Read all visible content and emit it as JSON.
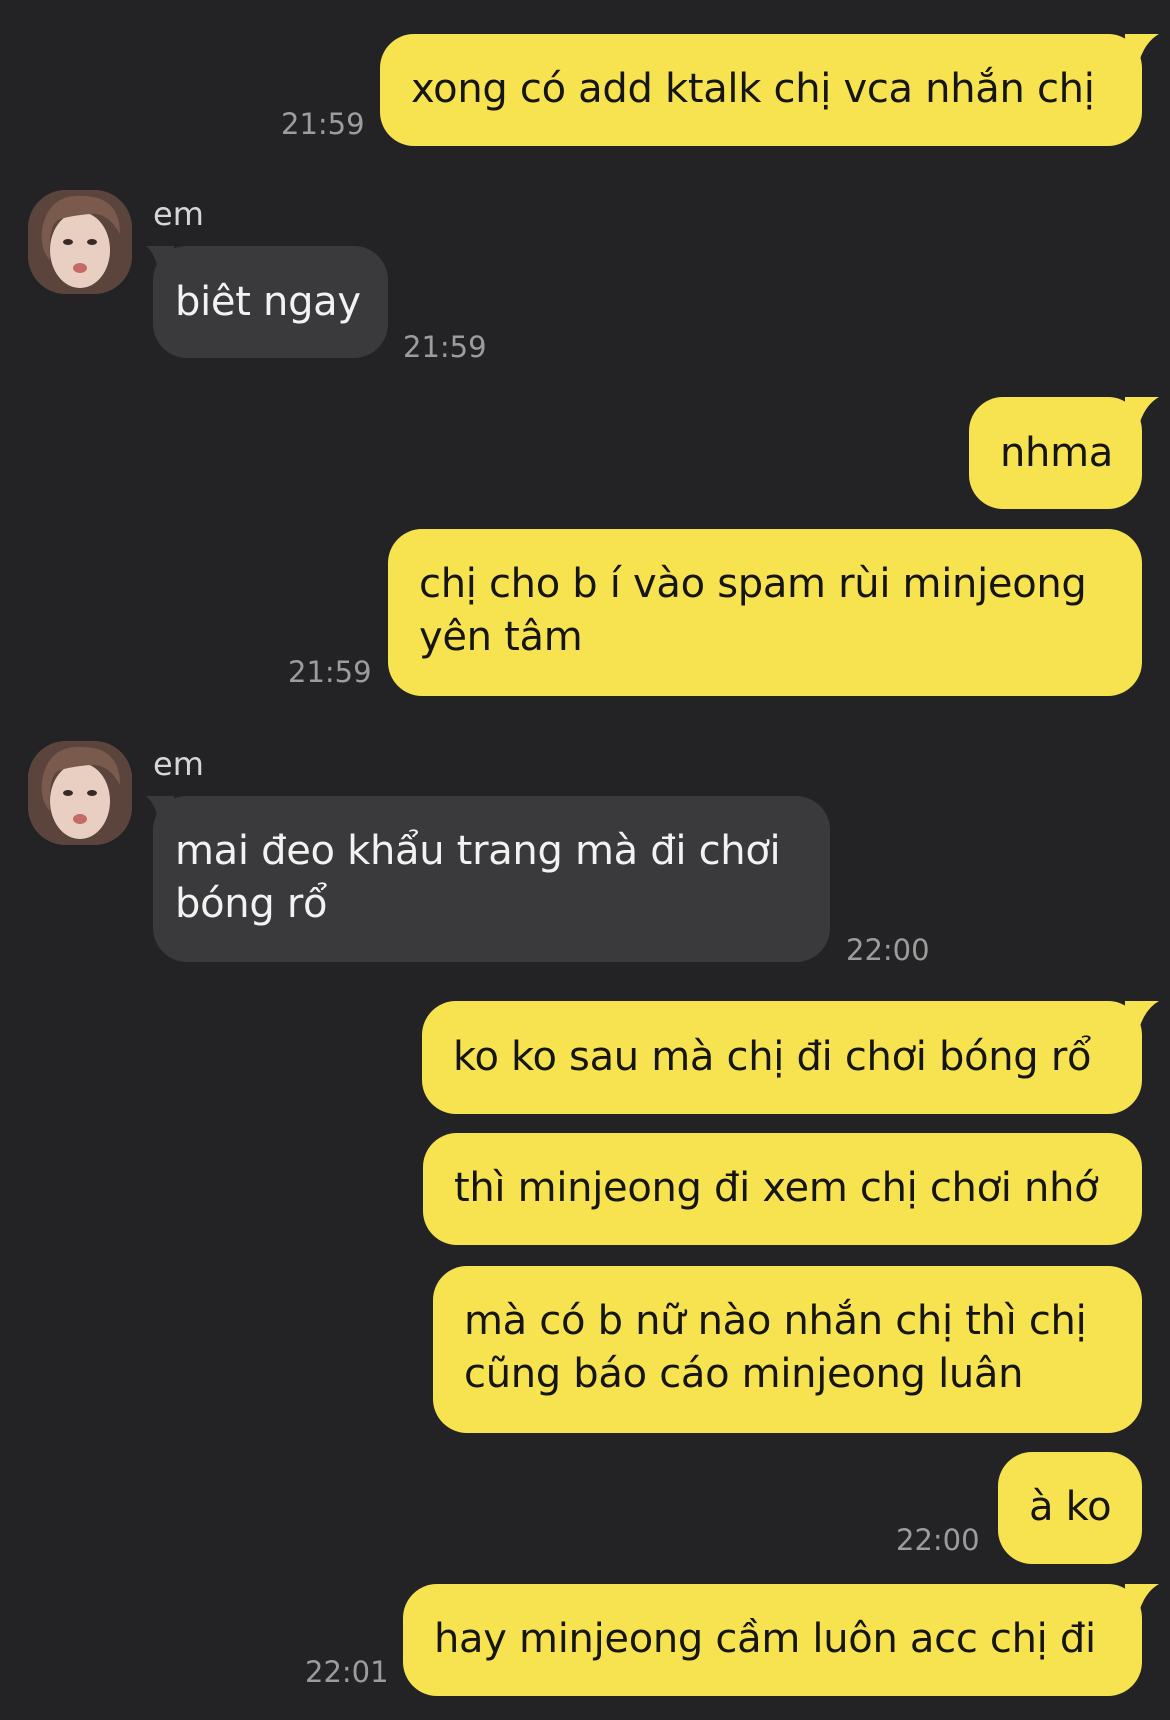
{
  "colors": {
    "background": "#232325",
    "outgoing_bubble": "#f7e350",
    "incoming_bubble": "#3a3a3c",
    "timestamp": "#9c9c9c"
  },
  "messages": [
    {
      "direction": "out",
      "lines": [
        "xong có add ktalk chị vca nhắn chị"
      ],
      "time": "21:59"
    },
    {
      "direction": "in",
      "sender": "em",
      "avatar": "profile-photo",
      "lines": [
        "biêt ngay"
      ],
      "time": "21:59"
    },
    {
      "direction": "out",
      "lines": [
        "nhma"
      ],
      "time": ""
    },
    {
      "direction": "out",
      "lines": [
        "chị cho b í vào spam rùi minjeong",
        "yên tâm"
      ],
      "time": "21:59"
    },
    {
      "direction": "in",
      "sender": "em",
      "avatar": "profile-photo",
      "lines": [
        "mai đeo khẩu trang mà đi chơi",
        "bóng rổ"
      ],
      "time": "22:00"
    },
    {
      "direction": "out",
      "lines": [
        "ko ko sau mà chị đi chơi bóng rổ"
      ],
      "time": ""
    },
    {
      "direction": "out",
      "lines": [
        "thì minjeong đi xem chị chơi nhớ"
      ],
      "time": ""
    },
    {
      "direction": "out",
      "lines": [
        "mà có b nữ nào nhắn chị thì chị",
        "cũng báo cáo minjeong luân"
      ],
      "time": ""
    },
    {
      "direction": "out",
      "lines": [
        "à ko"
      ],
      "time": "22:00"
    },
    {
      "direction": "out",
      "lines": [
        "hay minjeong cầm luôn acc chị đi"
      ],
      "time": "22:01"
    }
  ]
}
